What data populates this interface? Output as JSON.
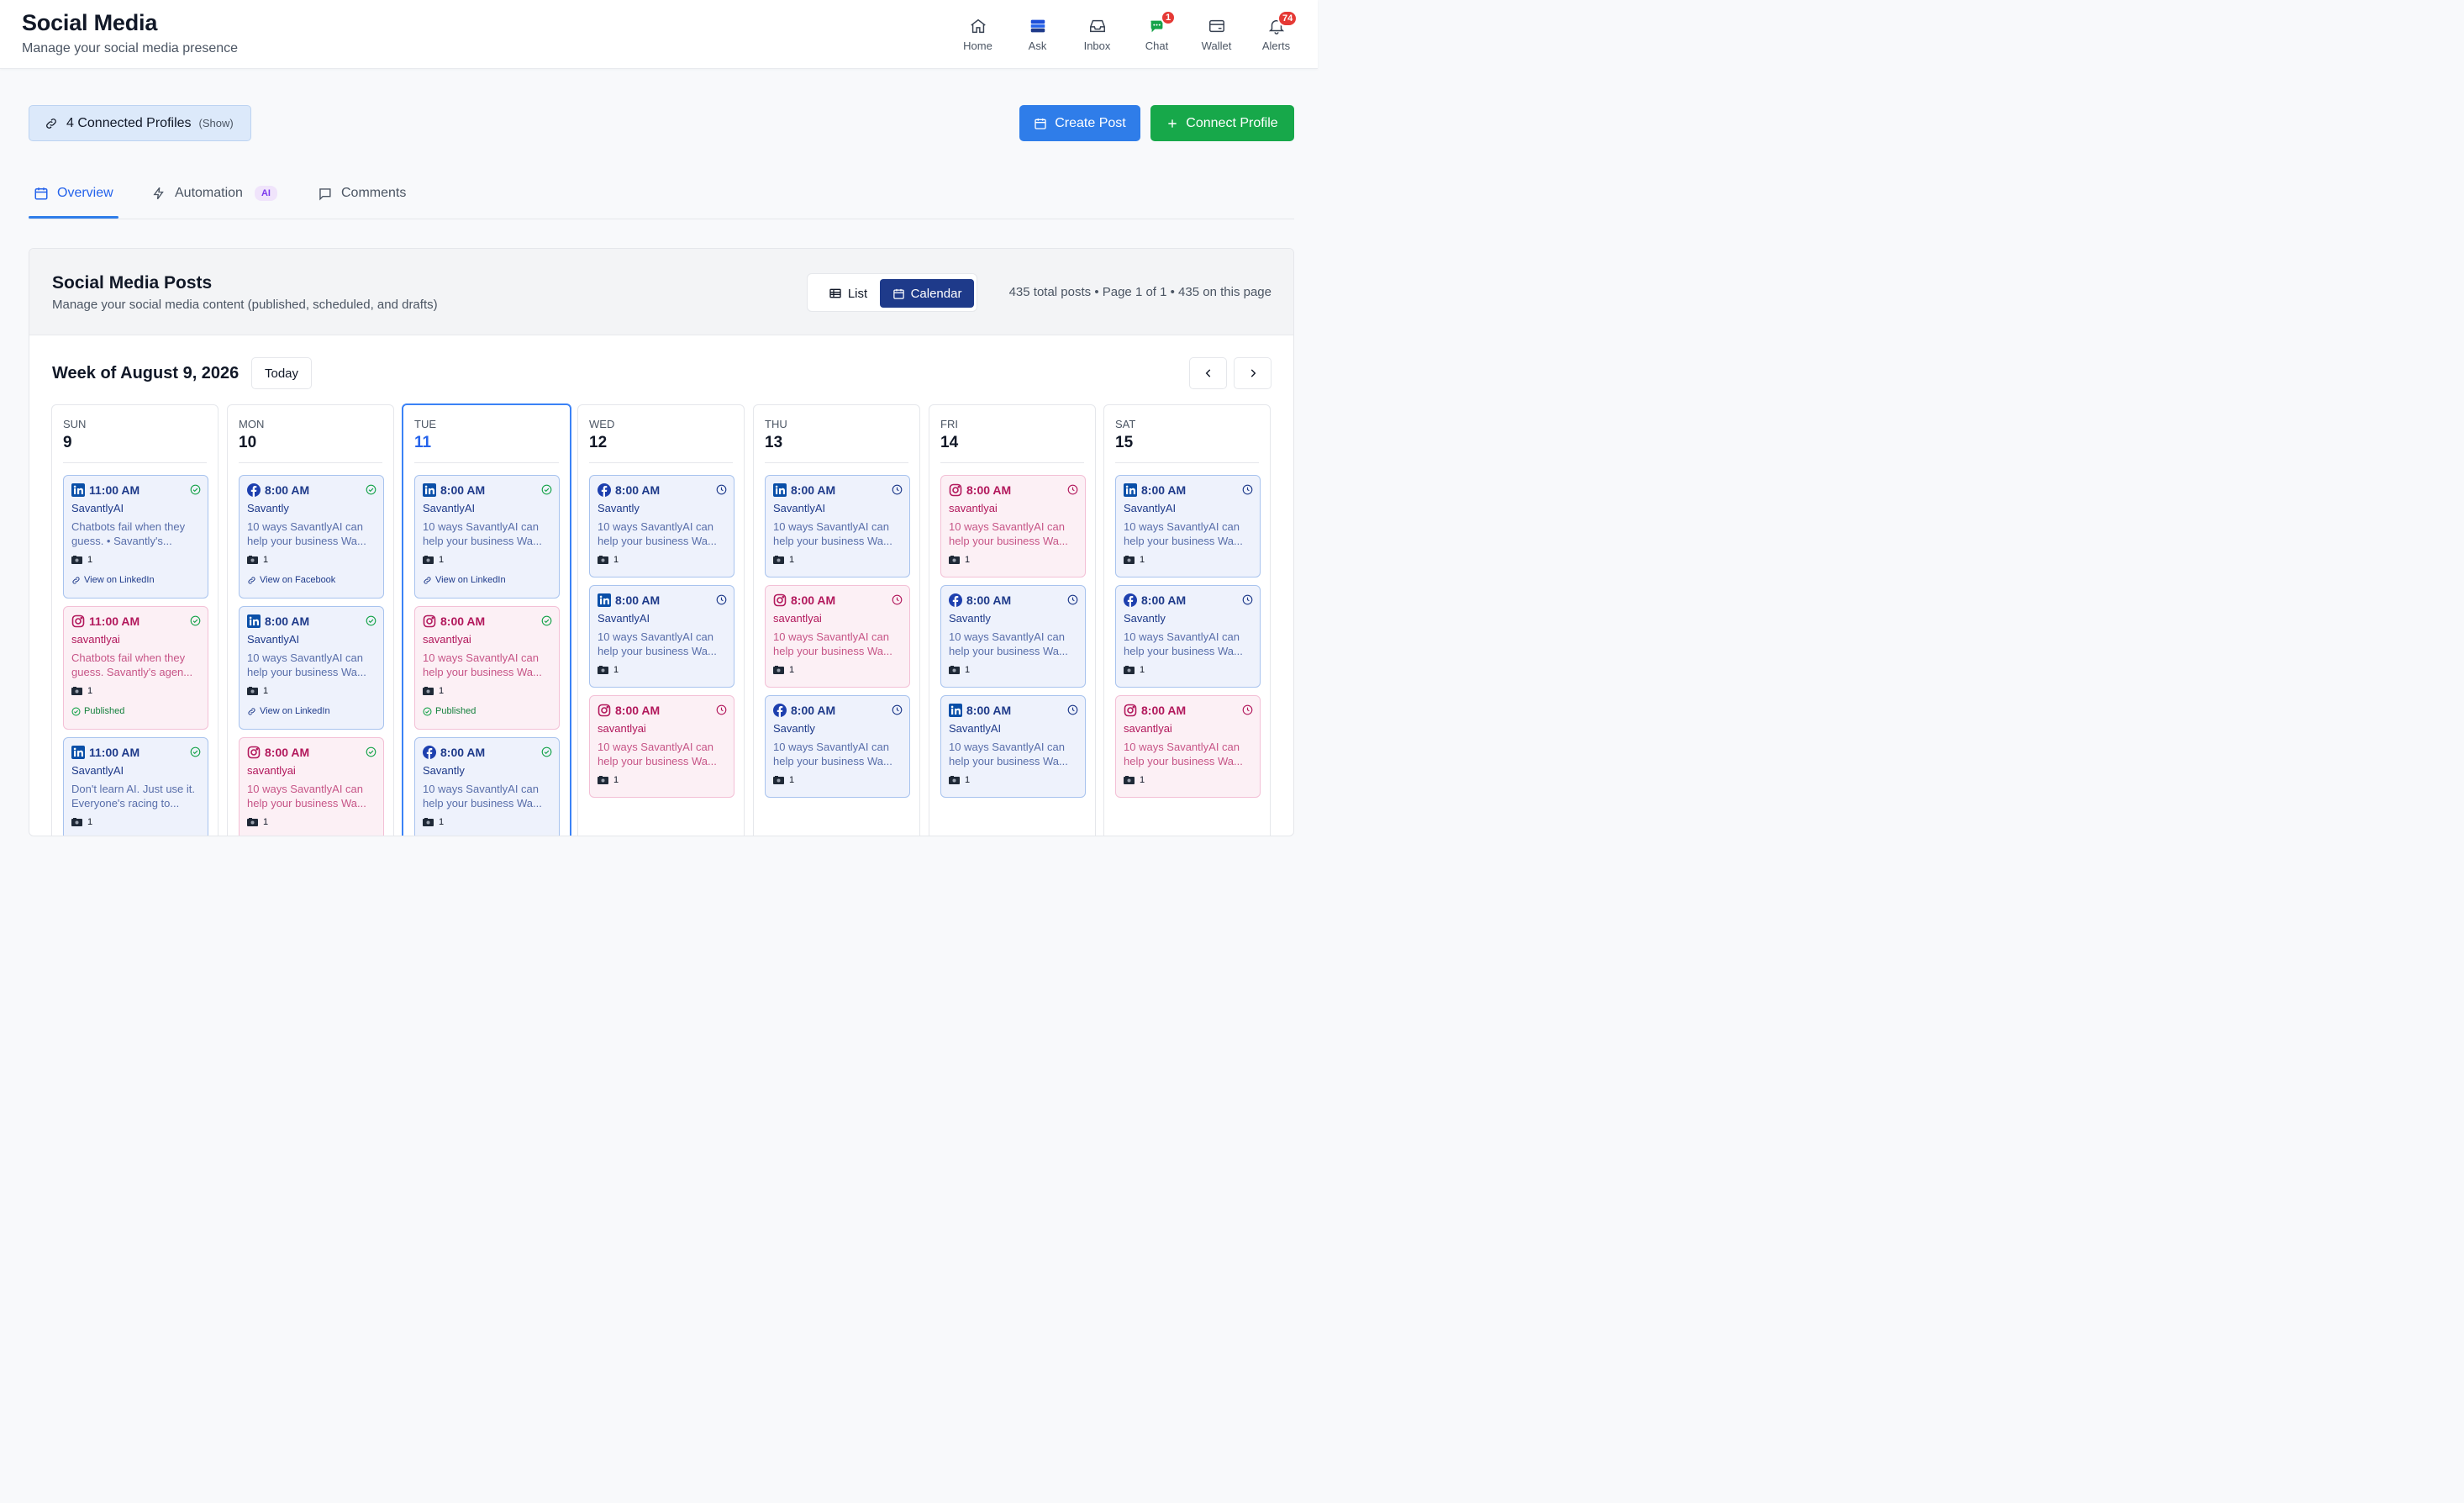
{
  "header": {
    "title": "Social Media",
    "subtitle": "Manage your social media presence",
    "nav": [
      {
        "label": "Home",
        "icon": "home-icon"
      },
      {
        "label": "Ask",
        "icon": "ask-icon"
      },
      {
        "label": "Inbox",
        "icon": "inbox-icon"
      },
      {
        "label": "Chat",
        "icon": "chat-icon",
        "badge": "1"
      },
      {
        "label": "Wallet",
        "icon": "wallet-icon"
      },
      {
        "label": "Alerts",
        "icon": "bell-icon",
        "badge": "74"
      }
    ]
  },
  "toolbar": {
    "profiles_label": "4 Connected Profiles",
    "profiles_show": "(Show)",
    "create_post": "Create Post",
    "connect_profile": "Connect Profile"
  },
  "tabs": [
    {
      "label": "Overview",
      "icon": "calendar-icon",
      "active": true
    },
    {
      "label": "Automation",
      "icon": "bolt-icon",
      "pill": "AI"
    },
    {
      "label": "Comments",
      "icon": "comment-icon"
    }
  ],
  "panel": {
    "title": "Social Media Posts",
    "subtitle": "Manage your social media content (published, scheduled, and drafts)",
    "view_list": "List",
    "view_calendar": "Calendar",
    "stats": "435 total posts • Page 1 of 1 • 435 on this page"
  },
  "calendar": {
    "week_title": "Week of August 9, 2026",
    "today_label": "Today",
    "days": [
      {
        "name": "SUN",
        "num": "9",
        "posts": [
          {
            "platform": "linkedin",
            "time": "11:00 AM",
            "author": "SavantlyAI",
            "text": "Chatbots fail when they guess. • Savantly's...",
            "media": "1",
            "link": "View on LinkedIn",
            "status": "published"
          },
          {
            "platform": "instagram",
            "time": "11:00 AM",
            "author": "savantlyai",
            "text": "Chatbots fail when they guess. Savantly's agen...",
            "media": "1",
            "link": "Published",
            "status": "published"
          },
          {
            "platform": "linkedin",
            "time": "11:00 AM",
            "author": "SavantlyAI",
            "text": "Don't learn AI. Just use it. Everyone's racing to...",
            "media": "1",
            "link": "",
            "status": "published"
          }
        ]
      },
      {
        "name": "MON",
        "num": "10",
        "posts": [
          {
            "platform": "facebook",
            "time": "8:00 AM",
            "author": "Savantly",
            "text": "10 ways SavantlyAI can help your business Wa...",
            "media": "1",
            "link": "View on Facebook",
            "status": "published"
          },
          {
            "platform": "linkedin",
            "time": "8:00 AM",
            "author": "SavantlyAI",
            "text": "10 ways SavantlyAI can help your business Wa...",
            "media": "1",
            "link": "View on LinkedIn",
            "status": "published"
          },
          {
            "platform": "instagram",
            "time": "8:00 AM",
            "author": "savantlyai",
            "text": "10 ways SavantlyAI can help your business Wa...",
            "media": "1",
            "link": "",
            "status": "published"
          }
        ]
      },
      {
        "name": "TUE",
        "num": "11",
        "today": true,
        "posts": [
          {
            "platform": "linkedin",
            "time": "8:00 AM",
            "author": "SavantlyAI",
            "text": "10 ways SavantlyAI can help your business Wa...",
            "media": "1",
            "link": "View on LinkedIn",
            "status": "published"
          },
          {
            "platform": "instagram",
            "time": "8:00 AM",
            "author": "savantlyai",
            "text": "10 ways SavantlyAI can help your business Wa...",
            "media": "1",
            "link": "Published",
            "status": "published"
          },
          {
            "platform": "facebook",
            "time": "8:00 AM",
            "author": "Savantly",
            "text": "10 ways SavantlyAI can help your business Wa...",
            "media": "1",
            "link": "",
            "status": "published"
          }
        ]
      },
      {
        "name": "WED",
        "num": "12",
        "posts": [
          {
            "platform": "facebook",
            "time": "8:00 AM",
            "author": "Savantly",
            "text": "10 ways SavantlyAI can help your business Wa...",
            "media": "1",
            "link": "",
            "status": "scheduled"
          },
          {
            "platform": "linkedin",
            "time": "8:00 AM",
            "author": "SavantlyAI",
            "text": "10 ways SavantlyAI can help your business Wa...",
            "media": "1",
            "link": "",
            "status": "scheduled"
          },
          {
            "platform": "instagram",
            "time": "8:00 AM",
            "author": "savantlyai",
            "text": "10 ways SavantlyAI can help your business Wa...",
            "media": "1",
            "link": "",
            "status": "scheduled"
          }
        ]
      },
      {
        "name": "THU",
        "num": "13",
        "posts": [
          {
            "platform": "linkedin",
            "time": "8:00 AM",
            "author": "SavantlyAI",
            "text": "10 ways SavantlyAI can help your business Wa...",
            "media": "1",
            "link": "",
            "status": "scheduled"
          },
          {
            "platform": "instagram",
            "time": "8:00 AM",
            "author": "savantlyai",
            "text": "10 ways SavantlyAI can help your business Wa...",
            "media": "1",
            "link": "",
            "status": "scheduled"
          },
          {
            "platform": "facebook",
            "time": "8:00 AM",
            "author": "Savantly",
            "text": "10 ways SavantlyAI can help your business Wa...",
            "media": "1",
            "link": "",
            "status": "scheduled"
          }
        ]
      },
      {
        "name": "FRI",
        "num": "14",
        "posts": [
          {
            "platform": "instagram",
            "time": "8:00 AM",
            "author": "savantlyai",
            "text": "10 ways SavantlyAI can help your business Wa...",
            "media": "1",
            "link": "",
            "status": "scheduled"
          },
          {
            "platform": "facebook",
            "time": "8:00 AM",
            "author": "Savantly",
            "text": "10 ways SavantlyAI can help your business Wa...",
            "media": "1",
            "link": "",
            "status": "scheduled"
          },
          {
            "platform": "linkedin",
            "time": "8:00 AM",
            "author": "SavantlyAI",
            "text": "10 ways SavantlyAI can help your business Wa...",
            "media": "1",
            "link": "",
            "status": "scheduled"
          }
        ]
      },
      {
        "name": "SAT",
        "num": "15",
        "posts": [
          {
            "platform": "linkedin",
            "time": "8:00 AM",
            "author": "SavantlyAI",
            "text": "10 ways SavantlyAI can help your business Wa...",
            "media": "1",
            "link": "",
            "status": "scheduled"
          },
          {
            "platform": "facebook",
            "time": "8:00 AM",
            "author": "Savantly",
            "text": "10 ways SavantlyAI can help your business Wa...",
            "media": "1",
            "link": "",
            "status": "scheduled"
          },
          {
            "platform": "instagram",
            "time": "8:00 AM",
            "author": "savantlyai",
            "text": "10 ways SavantlyAI can help your business Wa...",
            "media": "1",
            "link": "",
            "status": "scheduled"
          }
        ]
      }
    ]
  },
  "colors": {
    "primary": "#2f7de9",
    "success": "#17a84a",
    "calendar_active": "#1e3a8a",
    "linkedin": "#0a66c2",
    "facebook": "#1877f2",
    "instagram": "#c13584",
    "badge": "#e53935"
  }
}
